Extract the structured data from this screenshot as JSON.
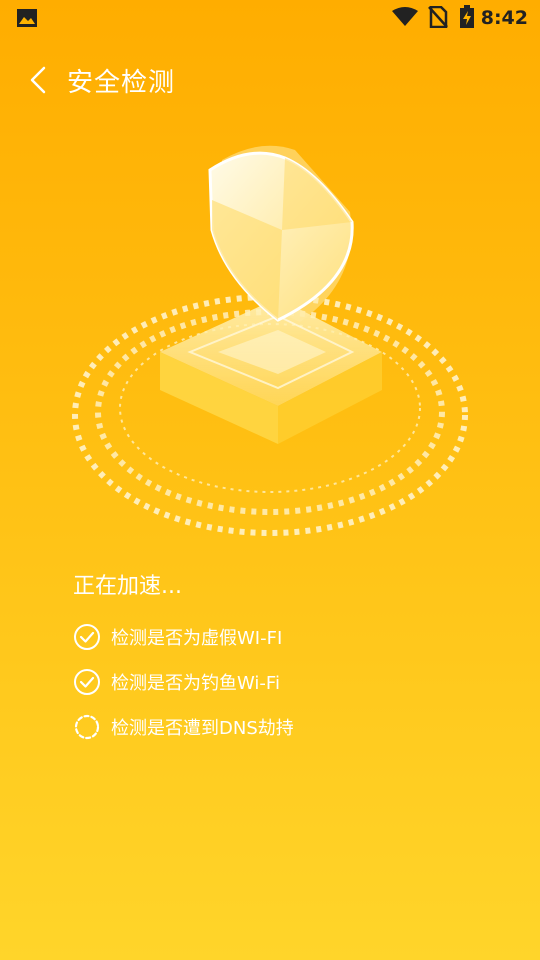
{
  "status_bar": {
    "time": "8:42",
    "icons": [
      "image-icon",
      "wifi-icon",
      "no-sim-icon",
      "battery-charging-icon"
    ]
  },
  "header": {
    "title": "安全检测",
    "back_icon": "chevron-left-icon"
  },
  "progress": {
    "title": "正在加速...",
    "items": [
      {
        "label": "检测是否为虚假WI-FI",
        "state": "done",
        "icon": "check-circle-icon"
      },
      {
        "label": "检测是否为钓鱼Wi-Fi",
        "state": "done",
        "icon": "check-circle-icon"
      },
      {
        "label": "检测是否遭到DNS劫持",
        "state": "loading",
        "icon": "spinner-icon"
      }
    ]
  },
  "colors": {
    "bg_top": "#ffad00",
    "bg_bottom": "#ffd52a",
    "text": "#ffffff",
    "status_icons": "#222222"
  }
}
